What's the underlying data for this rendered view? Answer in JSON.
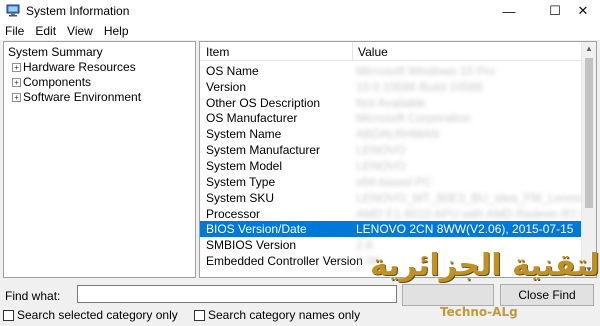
{
  "window": {
    "title": "System Information",
    "controls": {
      "minimize": "—",
      "maximize": "☐",
      "close": "✕"
    }
  },
  "menu": [
    "File",
    "Edit",
    "View",
    "Help"
  ],
  "tree": {
    "root": "System Summary",
    "children": [
      {
        "label": "Hardware Resources",
        "expander": "+"
      },
      {
        "label": "Components",
        "expander": "+"
      },
      {
        "label": "Software Environment",
        "expander": "+"
      }
    ]
  },
  "table": {
    "headers": {
      "item": "Item",
      "value": "Value"
    },
    "rows": [
      {
        "item": "OS Name",
        "value": "Microsoft Windows 10 Pro"
      },
      {
        "item": "Version",
        "value": "10.0.10586 Build 10586"
      },
      {
        "item": "Other OS Description",
        "value": "Not Available"
      },
      {
        "item": "OS Manufacturer",
        "value": "Microsoft Corporation"
      },
      {
        "item": "System Name",
        "value": "ABDALRHMAN"
      },
      {
        "item": "System Manufacturer",
        "value": "LENOVO"
      },
      {
        "item": "System Model",
        "value": "LENOVO"
      },
      {
        "item": "System Type",
        "value": "x64-based PC"
      },
      {
        "item": "System SKU",
        "value": "LENOVO_MT_80E3_BU_idea_FM_Lenovo G50-45"
      },
      {
        "item": "Processor",
        "value": "AMD E1-6010 APU with AMD Radeon R2 Graphics"
      },
      {
        "item": "BIOS Version/Date",
        "value": "LENOVO   2CN  8WW(V2.06), 2015-07-15",
        "selected": true
      },
      {
        "item": "SMBIOS Version",
        "value": "2.8"
      },
      {
        "item": "Embedded Controller Version",
        "value": "1.06"
      }
    ]
  },
  "find": {
    "label": "Find what:",
    "value": "",
    "close_button": "Close Find",
    "search_selected_label": "Search selected category only",
    "search_names_label": "Search category names only"
  },
  "watermark": {
    "arabic": "التقنية الجزائرية",
    "latin": "Techno-ALg"
  },
  "colors": {
    "selection": "#0078d7",
    "watermark": "#b9870f"
  }
}
